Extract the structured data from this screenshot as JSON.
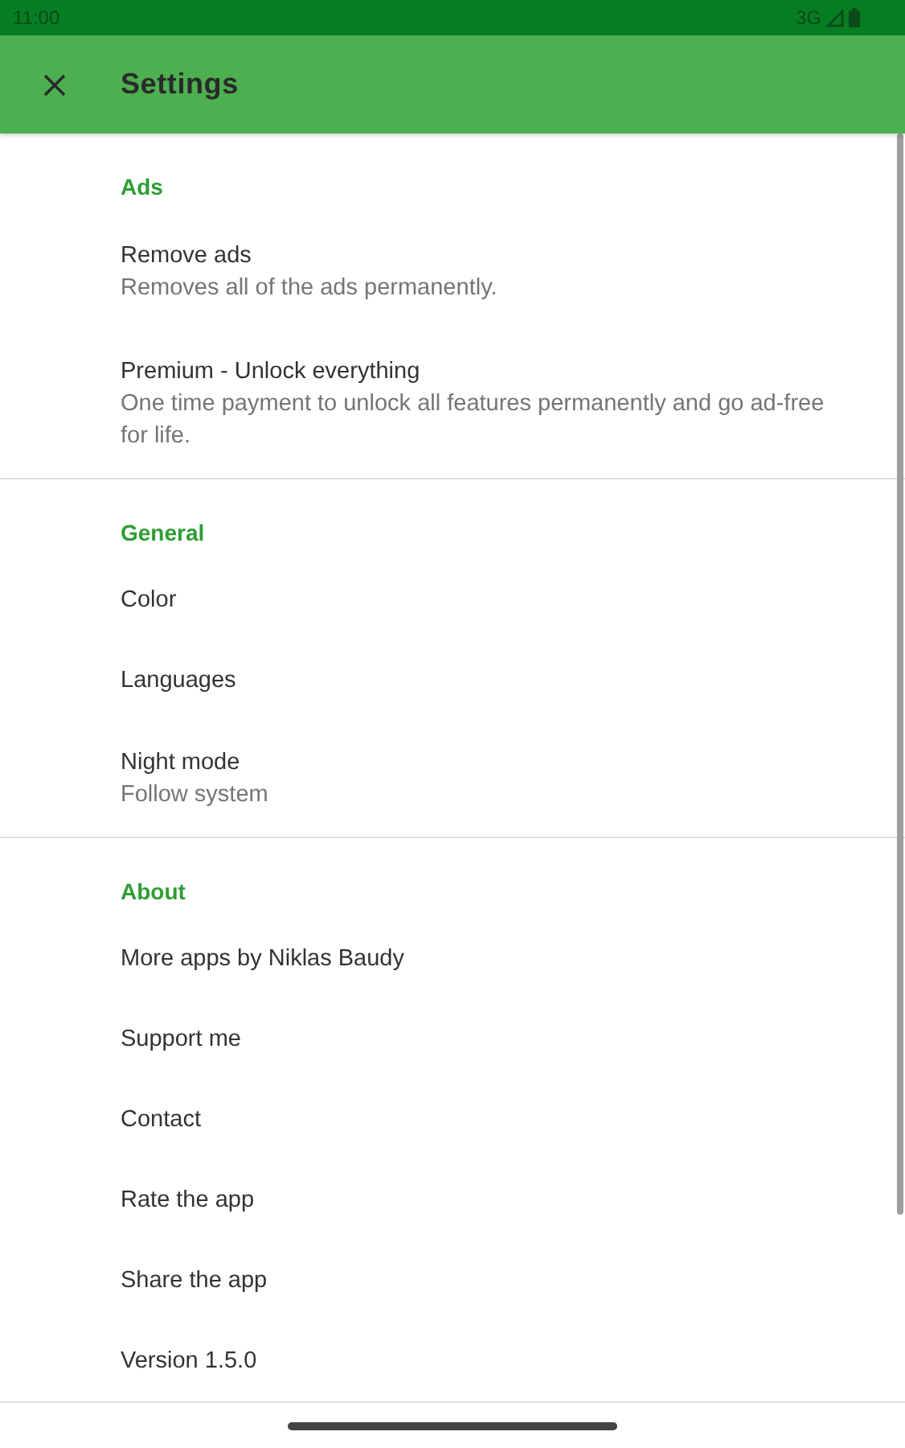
{
  "status_bar": {
    "time": "11:00",
    "network": "3G"
  },
  "app_bar": {
    "title": "Settings"
  },
  "sections": [
    {
      "title": "Ads",
      "items": [
        {
          "title": "Remove ads",
          "summary": "Removes all of the ads permanently."
        },
        {
          "title": "Premium - Unlock everything",
          "summary": "One time payment to unlock all features permanently and go ad-free for life."
        }
      ]
    },
    {
      "title": "General",
      "items": [
        {
          "title": "Color"
        },
        {
          "title": "Languages"
        },
        {
          "title": "Night mode",
          "summary": "Follow system"
        }
      ]
    },
    {
      "title": "About",
      "items": [
        {
          "title": "More apps by Niklas Baudy"
        },
        {
          "title": "Support me"
        },
        {
          "title": "Contact"
        },
        {
          "title": "Rate the app"
        },
        {
          "title": "Share the app"
        },
        {
          "title": "Version 1.5.0"
        }
      ]
    }
  ]
}
